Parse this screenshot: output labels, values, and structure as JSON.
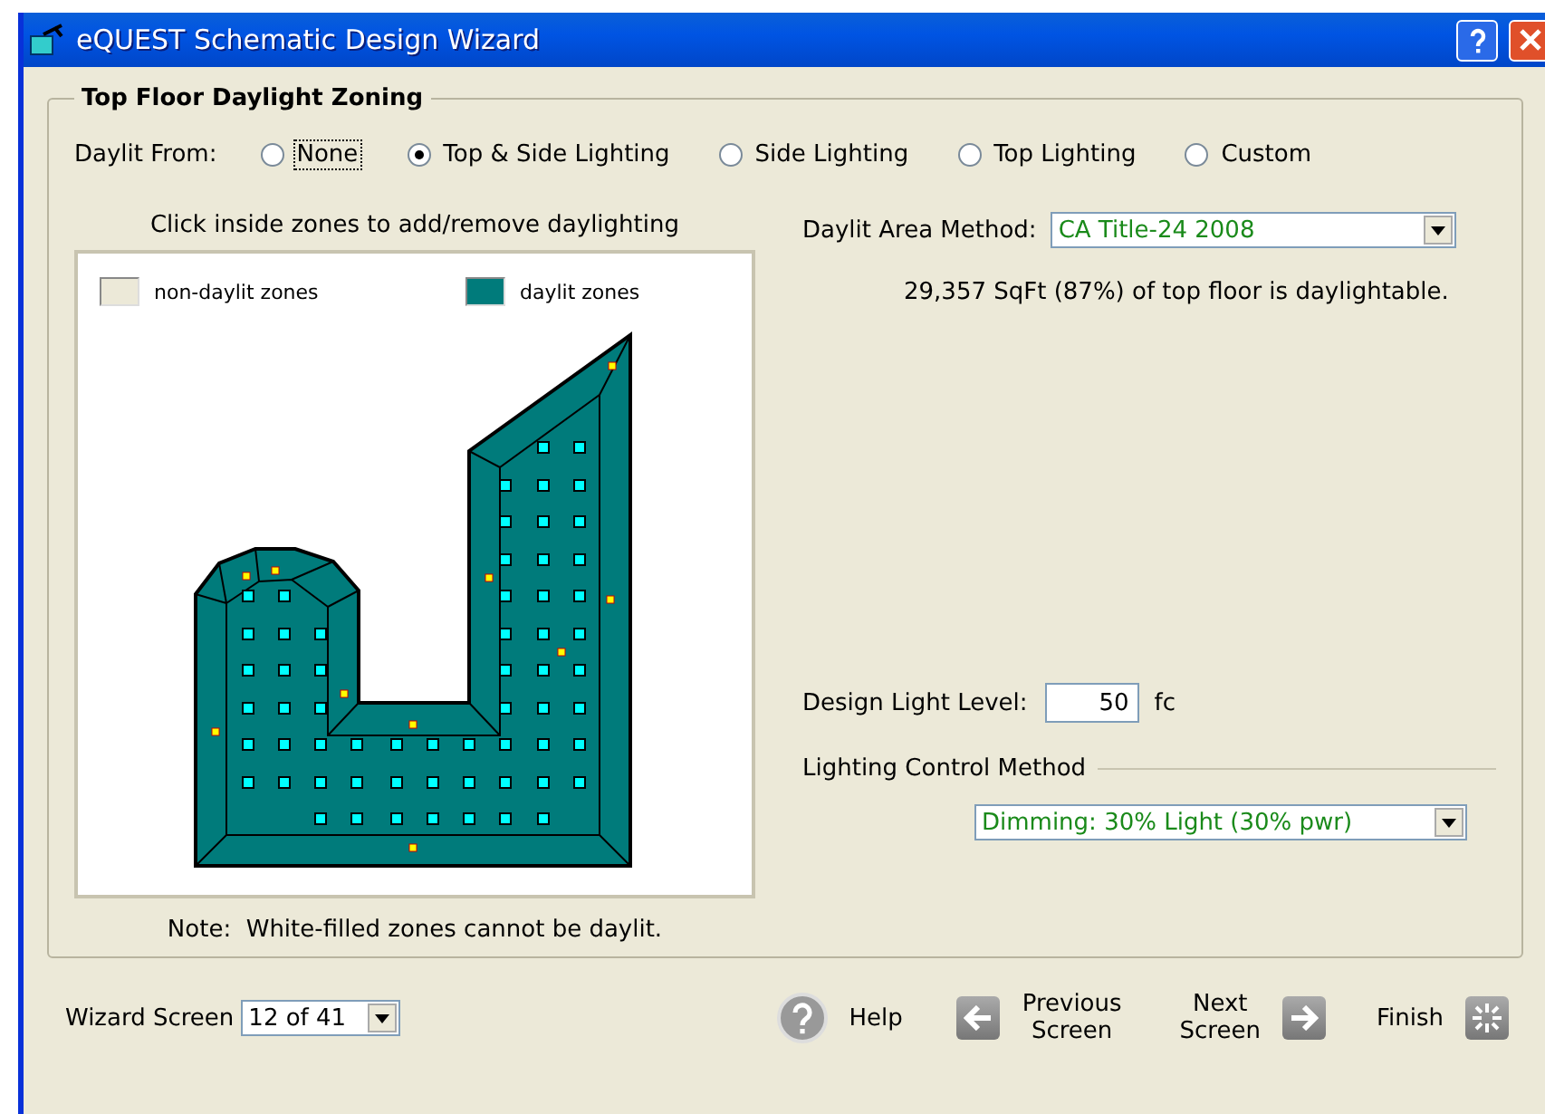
{
  "window": {
    "title": "eQUEST Schematic Design Wizard"
  },
  "group": {
    "title": "Top Floor Daylight Zoning"
  },
  "daylit_from": {
    "label": "Daylit From:",
    "options": [
      {
        "label": "None",
        "selected": false,
        "focused": true
      },
      {
        "label": "Top & Side Lighting",
        "selected": true,
        "focused": false
      },
      {
        "label": "Side Lighting",
        "selected": false,
        "focused": false
      },
      {
        "label": "Top Lighting",
        "selected": false,
        "focused": false
      },
      {
        "label": "Custom",
        "selected": false,
        "focused": false
      }
    ]
  },
  "plan": {
    "instruction": "Click inside zones to add/remove daylighting",
    "legend": [
      {
        "label": "non-daylit zones",
        "color": "#ece9d8"
      },
      {
        "label": "daylit zones",
        "color": "#007b7b"
      }
    ],
    "note": "Note:  White-filled zones cannot be daylit."
  },
  "daylit_area_method": {
    "label": "Daylit Area Method:",
    "value": "CA Title-24 2008"
  },
  "summary": "29,357 SqFt (87%) of top floor is daylightable.",
  "design_light_level": {
    "label": "Design Light Level:",
    "value": "50",
    "unit": "fc"
  },
  "lighting_control": {
    "title": "Lighting Control Method",
    "value": "Dimming: 30% Light (30% pwr)"
  },
  "footer": {
    "wizard_label": "Wizard Screen",
    "wizard_value": "12 of 41",
    "help": "Help",
    "previous": [
      "Previous",
      "Screen"
    ],
    "next": [
      "Next",
      "Screen"
    ],
    "finish": "Finish"
  }
}
